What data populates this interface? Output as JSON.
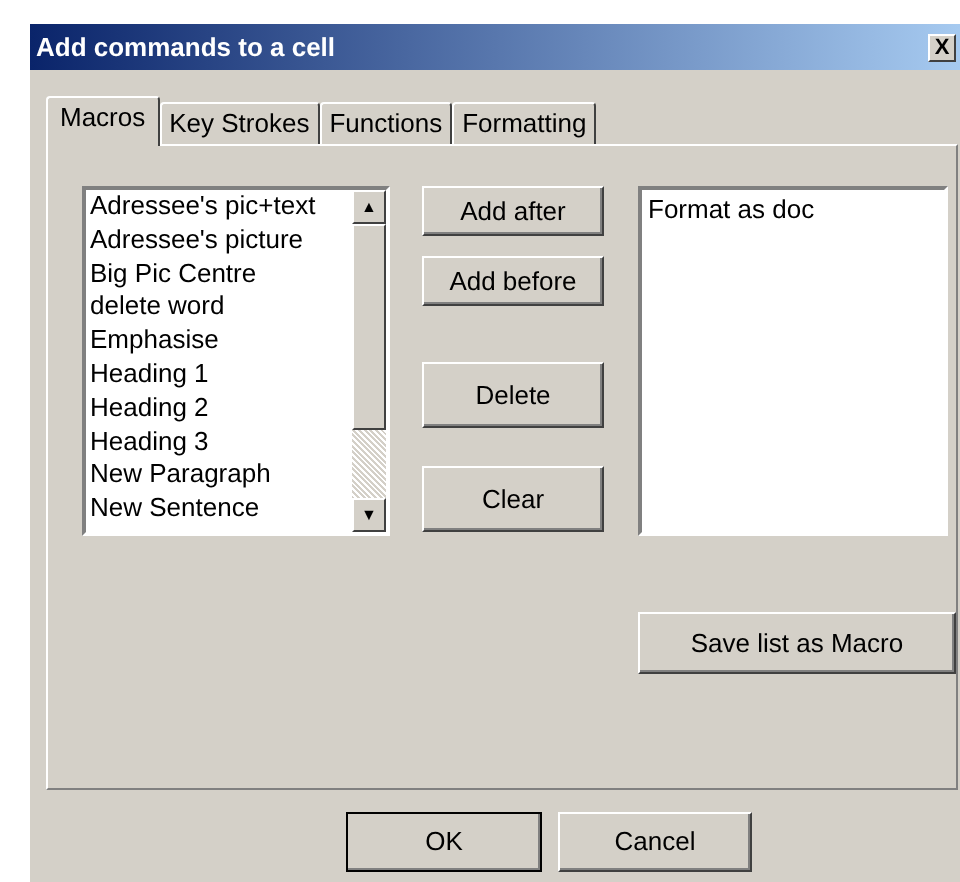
{
  "window": {
    "title": "Add commands to a cell",
    "close": "X"
  },
  "tabs": [
    {
      "label": "Macros",
      "selected": true
    },
    {
      "label": "Key Strokes",
      "selected": false
    },
    {
      "label": "Functions",
      "selected": false
    },
    {
      "label": "Formatting",
      "selected": false
    }
  ],
  "macro_list": {
    "items": [
      "Adressee's pic+text",
      "Adressee's picture",
      "Big Pic Centre",
      "delete word",
      "Emphasise",
      "Heading 1",
      "Heading 2",
      "Heading 3",
      "New Paragraph",
      "New Sentence"
    ],
    "scroll_up": "▲",
    "scroll_down": "▼"
  },
  "action_buttons": [
    "Add after",
    "Add before",
    "Delete",
    "Clear"
  ],
  "command_list": {
    "items": [
      "Format as doc"
    ]
  },
  "save_button": "Save list as Macro",
  "buttons": [
    "OK",
    "Cancel"
  ]
}
